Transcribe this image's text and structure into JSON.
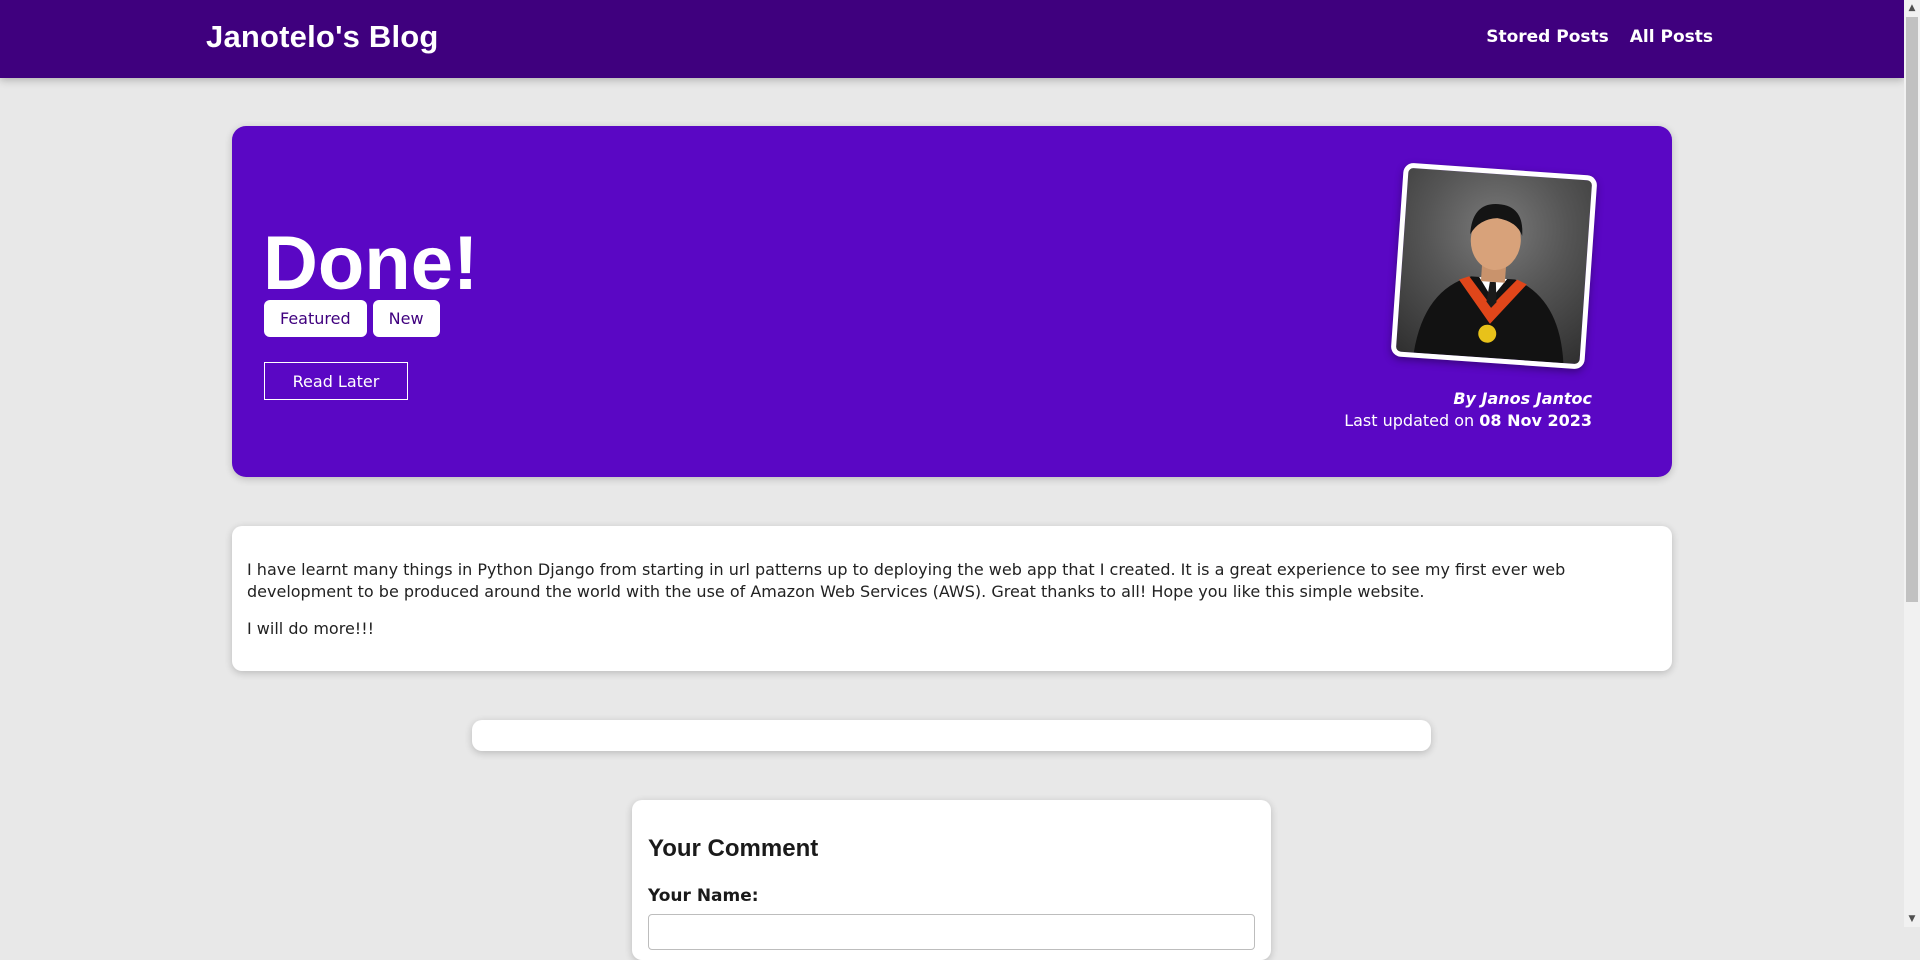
{
  "header": {
    "brand": "Janotelo's Blog",
    "nav": [
      {
        "label": "Stored Posts"
      },
      {
        "label": "All Posts"
      }
    ],
    "color": "#3f007e"
  },
  "post": {
    "title": "Done!",
    "tags": [
      "Featured",
      "New"
    ],
    "read_later_label": "Read Later",
    "author_line": "By Janos Jantoc",
    "updated_prefix": "Last updated on ",
    "updated_date": "08 Nov 2023",
    "hero_color": "#5a07c4",
    "content": [
      "I have learnt many things in Python Django from starting in url patterns up to deploying the web app that I created. It is a great experience to see my first ever web development to be produced around the world with the use of Amazon Web Services (AWS). Great thanks to all! Hope you like this simple website.",
      "I will do more!!!"
    ]
  },
  "comment_form": {
    "title": "Your Comment",
    "name_label": "Your Name:",
    "name_value": ""
  },
  "icons": {
    "scroll_up": "scroll-up-arrow-icon",
    "scroll_down": "scroll-down-arrow-icon"
  }
}
